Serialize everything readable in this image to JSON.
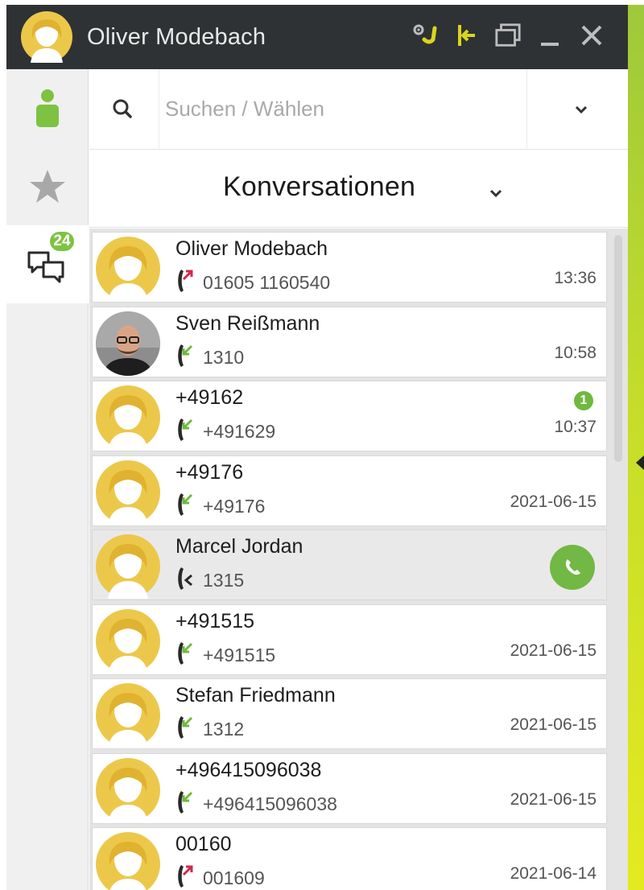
{
  "window": {
    "title": "Oliver Modebach",
    "controls": [
      {
        "icon": "status-settings-icon"
      },
      {
        "icon": "dock-pin-icon"
      },
      {
        "icon": "restore-window-icon"
      },
      {
        "icon": "minimize-icon"
      },
      {
        "icon": "close-icon"
      }
    ]
  },
  "colors": {
    "accent_green": "#7ec242",
    "titlebar": "#2f3234",
    "avatar_yellow": "#ecc84a",
    "outgoing_red": "#d4274a",
    "incoming_green": "#6fb93e"
  },
  "sidebar": {
    "items": [
      {
        "icon": "contact-person-icon"
      },
      {
        "icon": "favorites-star-icon"
      },
      {
        "icon": "conversations-icon",
        "badge": "24",
        "active": true
      }
    ]
  },
  "search": {
    "placeholder": "Suchen / Wählen"
  },
  "section": {
    "title": "Konversationen"
  },
  "conversations": [
    {
      "name": "Oliver Modebach",
      "number": "01605 1160540",
      "direction": "outgoing",
      "time": "13:36",
      "avatar": "default"
    },
    {
      "name": "Sven Reißmann",
      "number": "1310",
      "direction": "incoming",
      "time": "10:58",
      "avatar": "photo"
    },
    {
      "name": "+49162",
      "number": "+491629",
      "direction": "incoming",
      "time": "10:37",
      "unread": "1",
      "avatar": "default"
    },
    {
      "name": "+49176",
      "number": "+49176",
      "direction": "incoming",
      "time": "2021-06-15",
      "avatar": "default"
    },
    {
      "name": "Marcel Jordan",
      "number": "1315",
      "direction": "active",
      "time": "",
      "avatar": "default",
      "selected": true
    },
    {
      "name": "+491515",
      "number": "+491515",
      "direction": "incoming",
      "time": "2021-06-15",
      "avatar": "default"
    },
    {
      "name": "Stefan Friedmann",
      "number": "1312",
      "direction": "incoming",
      "time": "2021-06-15",
      "avatar": "default"
    },
    {
      "name": "+496415096038",
      "number": "+496415096038",
      "direction": "incoming",
      "time": "2021-06-15",
      "avatar": "default"
    },
    {
      "name": "00160",
      "number": "001609",
      "direction": "outgoing",
      "time": "2021-06-14",
      "avatar": "default"
    }
  ]
}
